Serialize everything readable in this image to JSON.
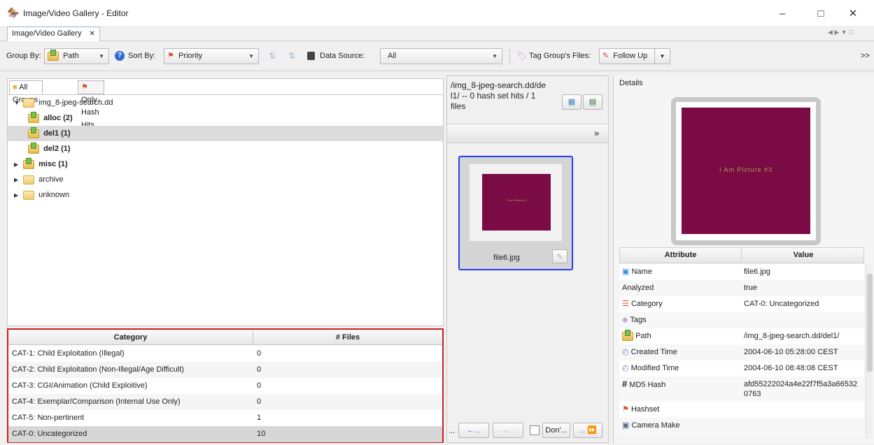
{
  "window": {
    "title": "Image/Video Gallery - Editor",
    "minimize": "–",
    "maximize": "□",
    "close": "✕"
  },
  "tab": {
    "label": "Image/Video Gallery",
    "close": "✕"
  },
  "toolbar": {
    "group_by_label": "Group By:",
    "group_by_value": "Path",
    "sort_by_label": "Sort By:",
    "sort_by_value": "Priority",
    "data_source_label": "Data Source:",
    "data_source_value": "All",
    "tag_label": "Tag Group's Files:",
    "tag_value": "Follow Up",
    "overflow": ">>"
  },
  "left": {
    "tabs": [
      "All Groups",
      "Only Hash Hits"
    ],
    "tree": [
      {
        "label": "img_8-jpeg-search.dd",
        "level": 0,
        "expander": "▼",
        "bold": false
      },
      {
        "label": "alloc (2)",
        "level": 1,
        "expander": "",
        "bold": true
      },
      {
        "label": "del1 (1)",
        "level": 1,
        "expander": "",
        "bold": true,
        "selected": true
      },
      {
        "label": "del2 (1)",
        "level": 1,
        "expander": "",
        "bold": true
      },
      {
        "label": "misc (1)",
        "level": 1,
        "expander": "▶",
        "bold": true
      },
      {
        "label": "archive",
        "level": 1,
        "expander": "▶",
        "bold": false
      },
      {
        "label": "unknown",
        "level": 1,
        "expander": "▶",
        "bold": false
      }
    ]
  },
  "categories": {
    "headers": [
      "Category",
      "# Files"
    ],
    "rows": [
      {
        "category": "CAT-1: Child Exploitation (Illegal)",
        "files": "0"
      },
      {
        "category": "CAT-2: Child Exploitation (Non-Illegal/Age Difficult)",
        "files": "0"
      },
      {
        "category": "CAT-3: CGI/Animation (Child Exploitive)",
        "files": "0"
      },
      {
        "category": "CAT-4: Exemplar/Comparison (Internal Use Only)",
        "files": "0"
      },
      {
        "category": "CAT-5: Non-pertinent",
        "files": "1"
      },
      {
        "category": "CAT-0: Uncategorized",
        "files": "10"
      }
    ]
  },
  "middle": {
    "header_lines": [
      "/img_8-jpeg-search.dd/de",
      "l1/ -- 0 hash set hits / 1",
      "files"
    ],
    "overflow": "»",
    "thumb_caption": "file6.jpg",
    "thumb_text": "I Am Picture #3",
    "nav": {
      "back": "←...",
      "forward": "→...",
      "dont": "Don'...",
      "more": "... ⏩",
      "dots": "..."
    }
  },
  "details": {
    "title": "Details",
    "picture_text": "I Am Picture #3",
    "headers": [
      "Attribute",
      "Value"
    ],
    "rows": [
      {
        "attr": "Name",
        "value": "file6.jpg"
      },
      {
        "attr": "Analyzed",
        "value": "true"
      },
      {
        "attr": "Category",
        "value": "CAT-0: Uncategorized"
      },
      {
        "attr": "Tags",
        "value": ""
      },
      {
        "attr": "Path",
        "value": "/img_8-jpeg-search.dd/del1/"
      },
      {
        "attr": "Created Time",
        "value": "2004-06-10 05:28:00 CEST"
      },
      {
        "attr": "Modified Time",
        "value": "2004-06-10 08:48:08 CEST"
      },
      {
        "attr": "MD5 Hash",
        "value": "afd55222024a4e22f7f5a3a66532 0763"
      },
      {
        "attr": "Hashset",
        "value": ""
      },
      {
        "attr": "Camera Make",
        "value": ""
      }
    ]
  },
  "colors": {
    "selection_border": "#2540e8",
    "category_border": "#cc1f1f",
    "picture": "#7b0b44"
  }
}
